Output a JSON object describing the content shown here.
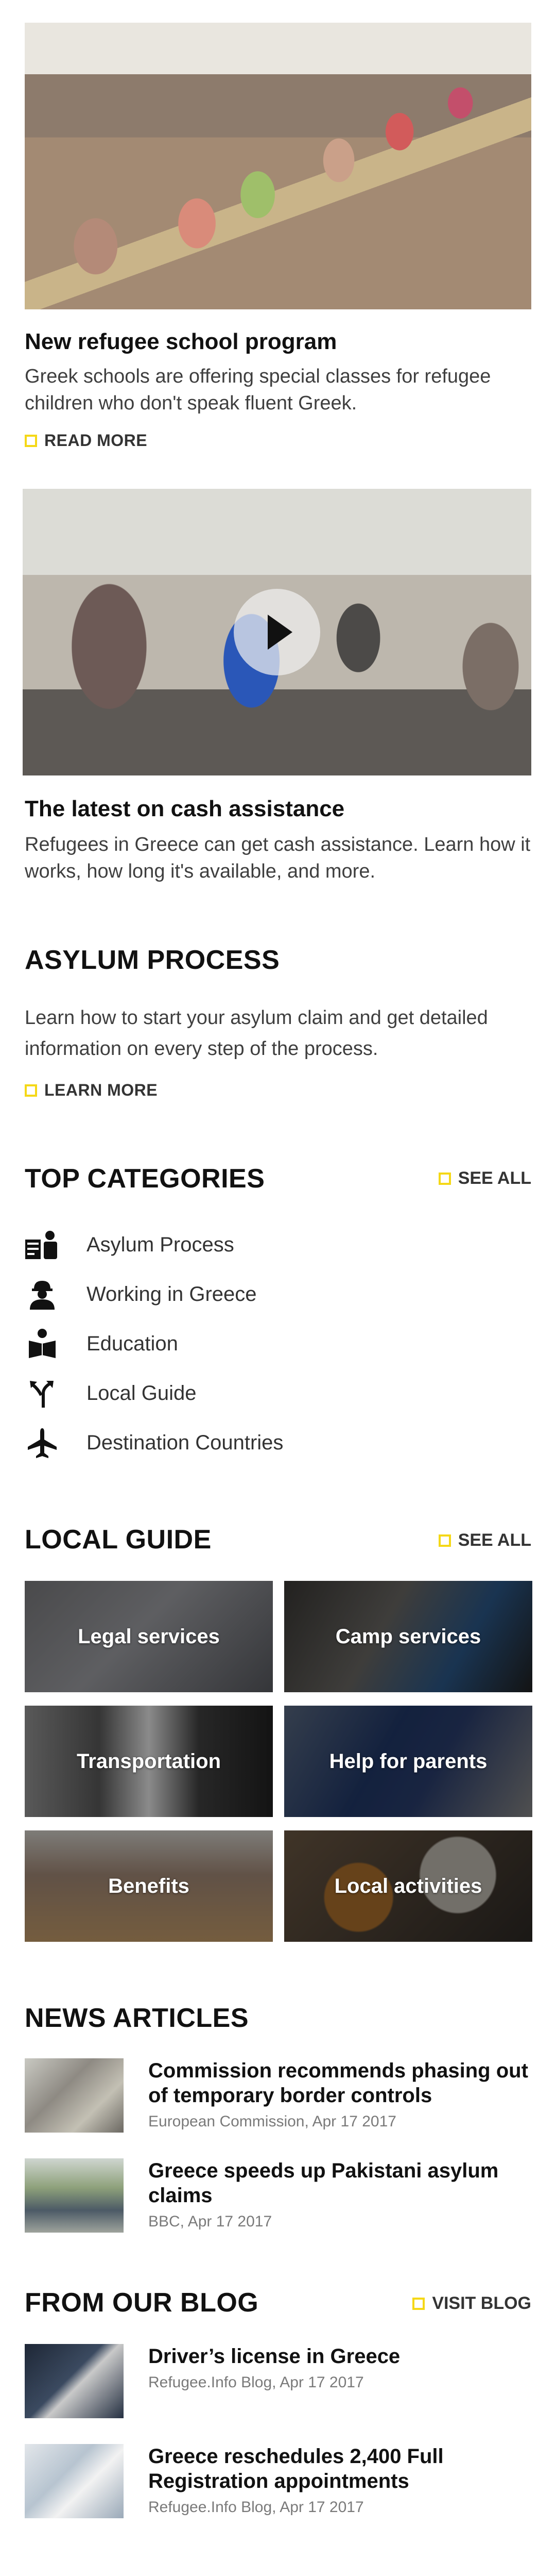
{
  "card1": {
    "title": "New refugee school program",
    "body": "Greek schools are offering special classes for refugee children who don't speak fluent Greek.",
    "link": "READ MORE"
  },
  "card2": {
    "title": "The latest on cash assistance",
    "body": "Refugees in Greece can get cash assistance. Learn how it works, how long it's available, and more."
  },
  "asylum": {
    "heading": "ASYLUM PROCESS",
    "body": "Learn how to start your asylum claim and get detailed information on every step of the process.",
    "link": "LEARN MORE"
  },
  "categories": {
    "heading": "TOP CATEGORIES",
    "see_all": "SEE ALL",
    "items": [
      {
        "label": "Asylum Process",
        "icon": "asylum-icon"
      },
      {
        "label": "Working in Greece",
        "icon": "worker-icon"
      },
      {
        "label": "Education",
        "icon": "education-icon"
      },
      {
        "label": "Local Guide",
        "icon": "directions-icon"
      },
      {
        "label": "Destination Countries",
        "icon": "airplane-icon"
      }
    ]
  },
  "local_guide": {
    "heading": "LOCAL GUIDE",
    "see_all": "SEE ALL",
    "tiles": [
      {
        "label": "Legal services"
      },
      {
        "label": "Camp services"
      },
      {
        "label": "Transportation"
      },
      {
        "label": "Help for parents"
      },
      {
        "label": "Benefits"
      },
      {
        "label": "Local activities"
      }
    ]
  },
  "news": {
    "heading": "NEWS ARTICLES",
    "items": [
      {
        "title": "Commission recommends phasing out of temporary border controls",
        "meta": "European Commission, Apr 17 2017"
      },
      {
        "title": "Greece speeds up Pakistani asylum claims",
        "meta": "BBC, Apr 17 2017"
      }
    ]
  },
  "blog": {
    "heading": "FROM OUR BLOG",
    "visit": "VISIT BLOG",
    "items": [
      {
        "title": "Driver’s license in Greece",
        "meta": "Refugee.Info Blog, Apr 17 2017"
      },
      {
        "title": "Greece reschedules 2,400 Full Registration appointments",
        "meta": "Refugee.Info Blog, Apr 17 2017"
      }
    ]
  },
  "colors": {
    "accent": "#f5d817"
  }
}
